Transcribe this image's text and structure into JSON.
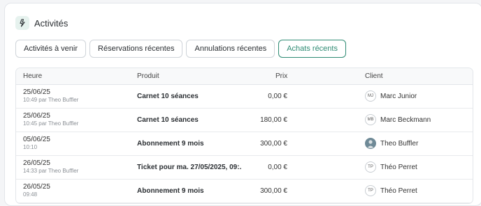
{
  "section": {
    "title": "Activités",
    "icon": "lightning-icon"
  },
  "tabs": [
    {
      "label": "Activités à venir",
      "active": false
    },
    {
      "label": "Réservations récentes",
      "active": false
    },
    {
      "label": "Annulations récentes",
      "active": false
    },
    {
      "label": "Achats récents",
      "active": true
    }
  ],
  "table": {
    "headers": {
      "heure": "Heure",
      "produit": "Produit",
      "prix": "Prix",
      "client": "Client"
    },
    "rows": [
      {
        "date": "25/06/25",
        "sub": "10:49 par Theo Buffler",
        "produit": "Carnet 10 séances",
        "prix": "0,00 €",
        "initials": "MJ",
        "client": "Marc Junior",
        "photo": false
      },
      {
        "date": "25/06/25",
        "sub": "10:45 par Theo Buffler",
        "produit": "Carnet 10 séances",
        "prix": "180,00 €",
        "initials": "MB",
        "client": "Marc Beckmann",
        "photo": false
      },
      {
        "date": "05/06/25",
        "sub": "10:10",
        "produit": "Abonnement 9 mois",
        "prix": "300,00 €",
        "initials": "",
        "client": "Theo Buffler",
        "photo": true
      },
      {
        "date": "26/05/25",
        "sub": "14:33 par Theo Buffler",
        "produit": "Ticket pour ma. 27/05/2025, 09:...",
        "prix": "0,00 €",
        "initials": "TP",
        "client": "Théo Perret",
        "photo": false
      },
      {
        "date": "26/05/25",
        "sub": "09:48",
        "produit": "Abonnement 9 mois",
        "prix": "300,00 €",
        "initials": "TP",
        "client": "Théo Perret",
        "photo": false
      }
    ]
  },
  "colors": {
    "accent": "#2e8b73",
    "accent_bg": "#e6f2ee"
  }
}
